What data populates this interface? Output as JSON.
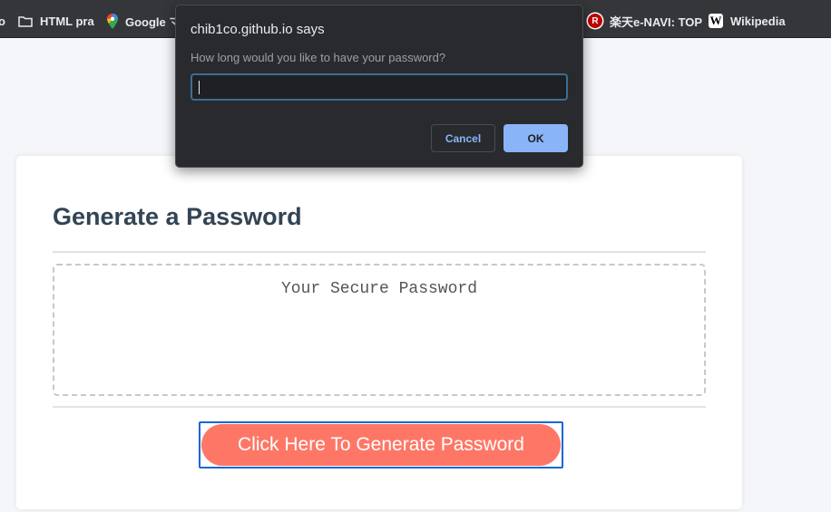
{
  "bookmarks": {
    "items": [
      {
        "label": "o",
        "icon": "truncated-bookmark"
      },
      {
        "label": "HTML pra",
        "icon": "folder-icon"
      },
      {
        "label": "Google マ",
        "icon": "google-maps-icon"
      },
      {
        "label": "楽天e-NAVI: TOP",
        "icon": "rakuten-icon",
        "badge": "R"
      },
      {
        "label": "Wikipedia",
        "icon": "wikipedia-icon",
        "badge": "W"
      }
    ]
  },
  "dialog": {
    "title": "chib1co.github.io says",
    "message": "How long would you like to have your password?",
    "input_value": "",
    "cancel_label": "Cancel",
    "ok_label": "OK"
  },
  "card": {
    "title": "Generate a Password",
    "password_placeholder": "Your Secure Password",
    "generate_label": "Click Here To Generate Password"
  },
  "colors": {
    "heading": "#334454",
    "button": "#fe7766",
    "dialog_bg": "#292a2d",
    "dialog_accent": "#8ab4f8"
  }
}
